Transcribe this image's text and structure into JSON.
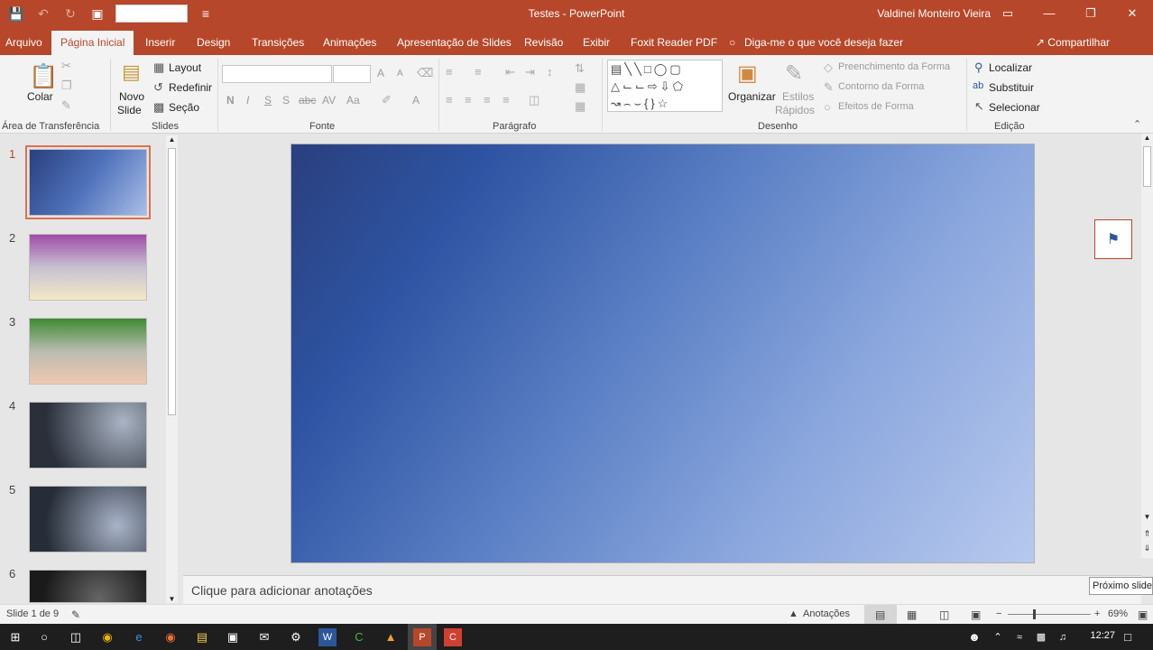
{
  "app": {
    "title": "Testes  -  PowerPoint",
    "user": "Valdinei Monteiro Vieira",
    "share_label": "Compartilhar"
  },
  "colors": {
    "accent": "#b7472a",
    "ribbon_bg": "#f3f3f3",
    "taskbar": "#1e1e1e"
  },
  "qat": {
    "icons": [
      "save-icon",
      "undo-icon",
      "redo-icon",
      "start-from-beginning-icon",
      "customize-qat-icon"
    ]
  },
  "window_controls": {
    "restore_ribbon": "▭",
    "minimize": "—",
    "restore": "❐",
    "close": "✕"
  },
  "tabs": [
    {
      "label": "Arquivo"
    },
    {
      "label": "Página Inicial"
    },
    {
      "label": "Inserir"
    },
    {
      "label": "Design"
    },
    {
      "label": "Transições"
    },
    {
      "label": "Animações"
    },
    {
      "label": "Apresentação de Slides"
    },
    {
      "label": "Revisão"
    },
    {
      "label": "Exibir"
    },
    {
      "label": "Foxit Reader PDF"
    },
    {
      "label": "Diga-me o que você deseja fazer"
    }
  ],
  "ribbon": {
    "clipboard": {
      "paste": "Colar",
      "group": "Área de Transferência"
    },
    "slides": {
      "new_slide_1": "Novo",
      "new_slide_2": "Slide",
      "layout": "Layout",
      "reset": "Redefinir",
      "section": "Seção",
      "group": "Slides"
    },
    "font": {
      "bold": "N",
      "italic": "I",
      "underline": "S",
      "shadow": "S",
      "strike": "abc",
      "spacing": "AV",
      "case": "Aa",
      "color": "A",
      "grow": "A",
      "shrink": "A",
      "group": "Fonte"
    },
    "paragraph": {
      "group": "Parágrafo"
    },
    "drawing": {
      "arrange_1": "Organizar",
      "styles_1": "Estilos",
      "styles_2": "Rápidos",
      "fill": "Preenchimento da Forma",
      "outline": "Contorno da Forma",
      "effects": "Efeitos de Forma",
      "group": "Desenho"
    },
    "editing": {
      "find": "Localizar",
      "replace": "Substituir",
      "select": "Selecionar",
      "group": "Edição"
    }
  },
  "slides": [
    {
      "num": "1",
      "active": true
    },
    {
      "num": "2"
    },
    {
      "num": "3"
    },
    {
      "num": "4"
    },
    {
      "num": "5"
    },
    {
      "num": "6"
    }
  ],
  "notes_placeholder": "Clique para adicionar anotações",
  "tooltip": "Próximo slide",
  "status": {
    "slide_info": "Slide 1 de 9",
    "notes": "Anotações",
    "zoom": "69%"
  },
  "taskbar": {
    "clock": "12:27"
  }
}
